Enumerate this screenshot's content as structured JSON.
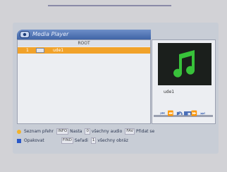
{
  "window": {
    "title": "Media Player"
  },
  "browser": {
    "header": "ROOT",
    "rows": [
      {
        "index": "1",
        "name": "ude1"
      }
    ]
  },
  "preview": {
    "filename": "ude1"
  },
  "footer": {
    "line1": [
      {
        "key": "",
        "label": "Seznam přehr"
      },
      {
        "key": "INFO",
        "label": "Nasta"
      },
      {
        "key": "0",
        "label": "všechny audio"
      },
      {
        "key": "FAV",
        "label": "Přidat se"
      }
    ],
    "line2": [
      {
        "key": "",
        "label": "Opakovat"
      },
      {
        "key": "FIND",
        "label": "Seřadi"
      },
      {
        "key": "1",
        "label": "všechny obráz"
      }
    ]
  },
  "colors": {
    "selection": "#f1a22a",
    "accent": "#4a6fb8",
    "yellow_key": "#f3b22a",
    "blue_key": "#2a58c8",
    "music_note": "#38c23a"
  }
}
